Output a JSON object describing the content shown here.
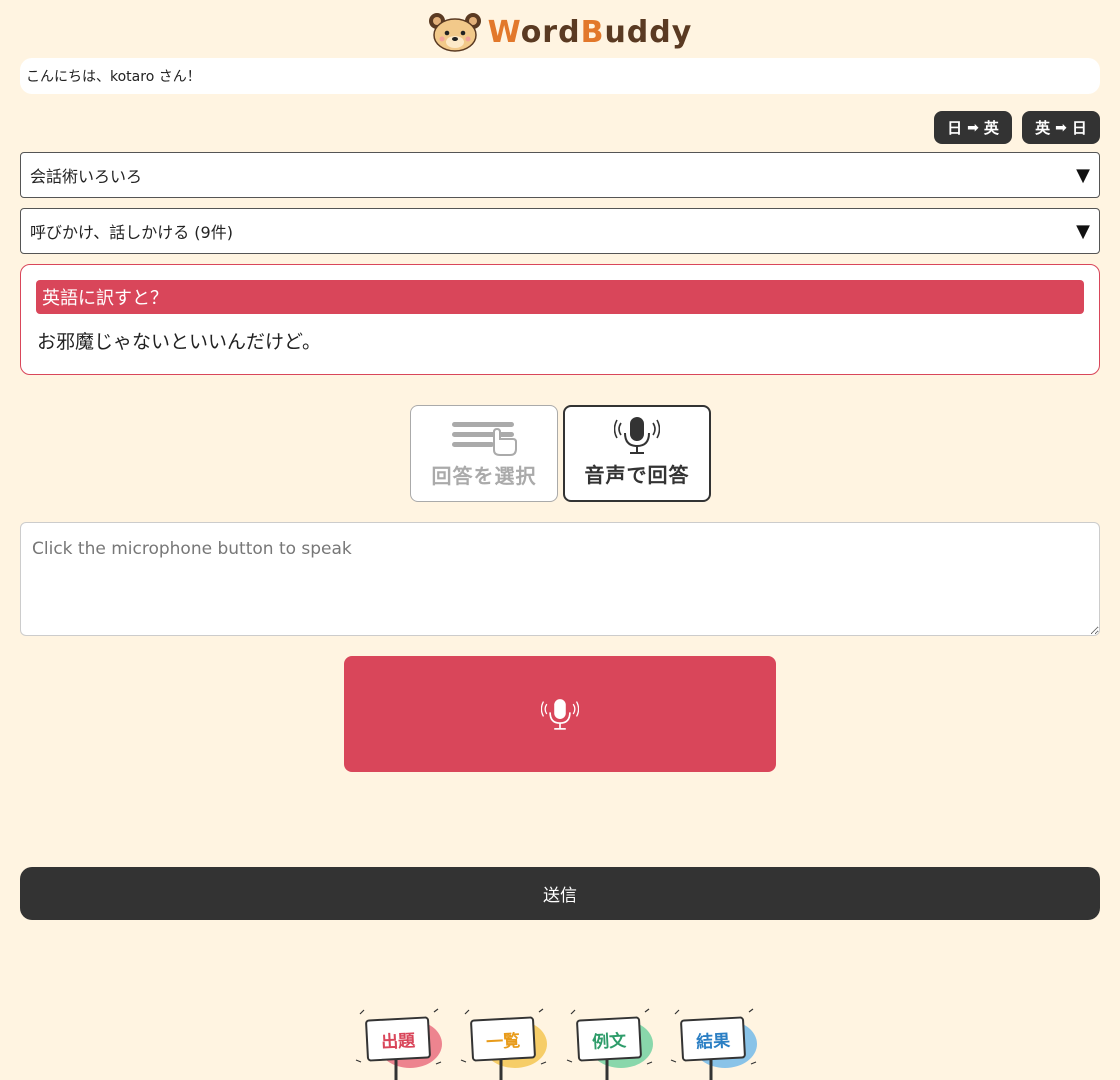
{
  "header": {
    "logo_text_1": "W",
    "logo_text_2": "ord",
    "logo_text_3": "B",
    "logo_text_4": "uddy"
  },
  "greeting": "こんにちは、kotaro さん！",
  "lang_toggle": {
    "ja_en": {
      "from": "日",
      "to": "英"
    },
    "en_ja": {
      "from": "英",
      "to": "日"
    }
  },
  "category_select": {
    "selected": "会話術いろいろ"
  },
  "subcategory_select": {
    "selected": "呼びかけ、話しかける (9件)"
  },
  "question": {
    "header": "英語に訳すと？",
    "text": "お邪魔じゃないといいんだけど。"
  },
  "answer_modes": {
    "select_label": "回答を選択",
    "voice_label": "音声で回答"
  },
  "answer_input": {
    "placeholder": "Click the microphone button to speak",
    "value": ""
  },
  "submit_label": "送信",
  "bottom_nav": [
    {
      "label": "出題",
      "color": "#d9465a",
      "accent": "#e9687a"
    },
    {
      "label": "一覧",
      "color": "#e89b1a",
      "accent": "#f4c34a"
    },
    {
      "label": "例文",
      "color": "#2e9c6a",
      "accent": "#6ccf9d"
    },
    {
      "label": "結果",
      "color": "#2b7fc4",
      "accent": "#6cb6ea"
    }
  ],
  "colors": {
    "accent": "#d9465a",
    "dark": "#333333",
    "background": "#fff4e1"
  }
}
